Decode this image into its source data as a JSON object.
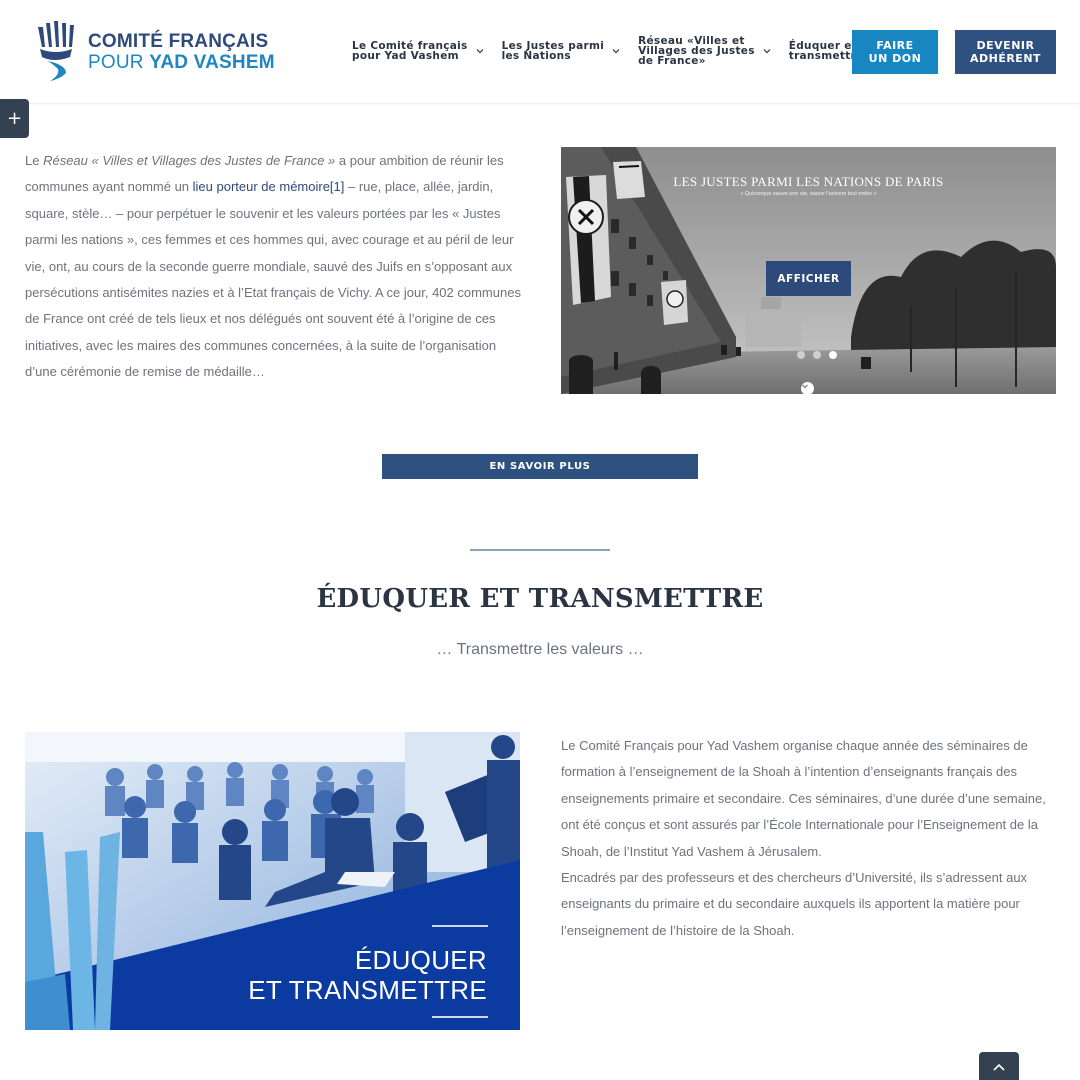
{
  "header": {
    "logo": {
      "line1": "COMITÉ FRANÇAIS",
      "line2_a": "POUR ",
      "line2_b": "YAD VASHEM"
    },
    "nav": [
      {
        "label": "Le Comité français\npour Yad Vashem"
      },
      {
        "label": "Les Justes parmi\nles Nations"
      },
      {
        "label": "Réseau «Villes et\nVillages des Justes\nde France»"
      },
      {
        "label": "Éduquer et\ntransmettre"
      }
    ],
    "donate_label": "FAIRE\nUN DON",
    "member_label": "DEVENIR\nADHÉRENT",
    "colors": {
      "primary": "#2e5180",
      "accent": "#1786c1",
      "dark": "#2b3442"
    }
  },
  "side_toggle": {
    "icon": "plus-icon",
    "symbol": "+"
  },
  "reseau": {
    "p_prefix": "Le ",
    "p_italic": "Réseau « Villes et Villages des Justes de France »",
    "p_mid": " a pour ambition de réunir les communes ayant nommé un ",
    "p_link": "lieu porteur de mémoire[1]",
    "p_rest": " – rue, place, allée, jardin, square, stèle… – pour perpétuer le souvenir et les valeurs portées par les  « Justes parmi les nations », ces femmes et ces hommes qui, avec courage et au péril de leur vie, ont, au cours de la seconde guerre mondiale, sauvé des Juifs en s’opposant aux persécutions antisémites nazies et à l’Etat français de Vichy. A ce jour, 402 communes de France ont créé de tels lieux et nos délégués ont souvent été à l’origine de ces initiatives, avec les maires des communes concernées, à la suite de l’organisation d’une cérémonie de remise de médaille…"
  },
  "slider": {
    "title": "LES JUSTES PARMI LES NATIONS DE PARIS",
    "subtitle": "« Quiconque sauve une vie, sauve l'univers tout entier »",
    "button": "AFFICHER",
    "dots": 3,
    "active_dot": 3
  },
  "more_button": "EN SAVOIR PLUS",
  "education": {
    "title": "ÉDUQUER ET TRANSMETTRE",
    "subtitle": "… Transmettre les valeurs …",
    "image_caption_1": "ÉDUQUER",
    "image_caption_2": "ET TRANSMETTRE",
    "para1": "Le Comité Français pour Yad Vashem organise chaque année des séminaires de formation à l’enseignement de la Shoah à l’intention d’enseignants français des enseignements primaire et secondaire. Ces séminaires, d’une durée d’une semaine, ont été conçus et sont assurés par l’École Internationale pour l’Enseignement de la Shoah, de l’Institut Yad Vashem à Jérusalem.",
    "para2": "Encadrés par des professeurs et des chercheurs d’Université, ils s’adressent aux enseignants du primaire et du secondaire auxquels ils apportent la matière pour l’enseignement de l’histoire de la Shoah."
  },
  "to_top": {
    "icon": "chevron-up-icon"
  }
}
